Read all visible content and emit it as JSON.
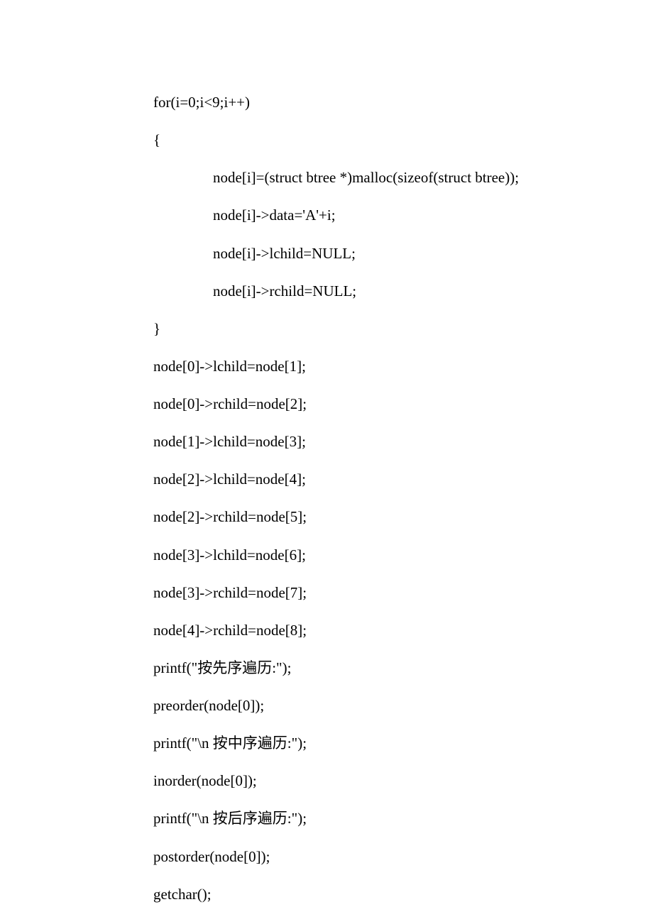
{
  "code": {
    "lines": [
      {
        "indent": 0,
        "text": "for(i=0;i<9;i++)"
      },
      {
        "indent": 0,
        "text": "{"
      },
      {
        "indent": 1,
        "text": "node[i]=(struct btree *)malloc(sizeof(struct btree));"
      },
      {
        "indent": 1,
        "text": "node[i]->data='A'+i;"
      },
      {
        "indent": 1,
        "text": "node[i]->lchild=NULL;"
      },
      {
        "indent": 1,
        "text": "node[i]->rchild=NULL;"
      },
      {
        "indent": 0,
        "text": "}"
      },
      {
        "indent": 0,
        "text": "node[0]->lchild=node[1];"
      },
      {
        "indent": 0,
        "text": "node[0]->rchild=node[2];"
      },
      {
        "indent": 0,
        "text": "node[1]->lchild=node[3];"
      },
      {
        "indent": 0,
        "text": "node[2]->lchild=node[4];"
      },
      {
        "indent": 0,
        "text": "node[2]->rchild=node[5];"
      },
      {
        "indent": 0,
        "text": "node[3]->lchild=node[6];"
      },
      {
        "indent": 0,
        "text": "node[3]->rchild=node[7];"
      },
      {
        "indent": 0,
        "text": "node[4]->rchild=node[8];"
      },
      {
        "indent": 0,
        "text": "printf(\"按先序遍历:\");"
      },
      {
        "indent": 0,
        "text": "preorder(node[0]);"
      },
      {
        "indent": 0,
        "text": "printf(\"\\n 按中序遍历:\");"
      },
      {
        "indent": 0,
        "text": "inorder(node[0]);"
      },
      {
        "indent": 0,
        "text": "printf(\"\\n 按后序遍历:\");"
      },
      {
        "indent": 0,
        "text": "postorder(node[0]);"
      },
      {
        "indent": 0,
        "text": "getchar();"
      }
    ]
  }
}
